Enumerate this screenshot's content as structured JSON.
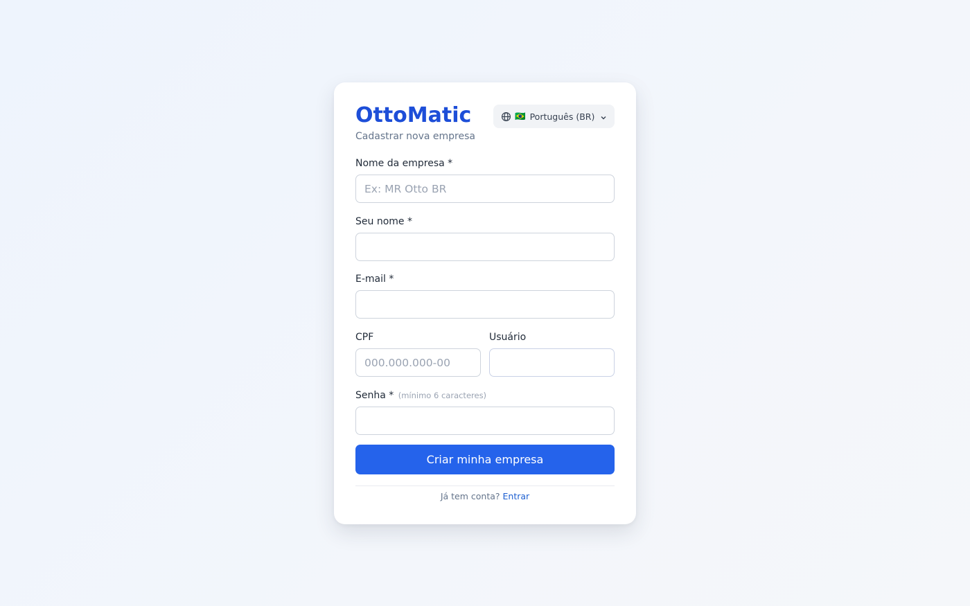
{
  "brand": {
    "name": "OttoMatic",
    "subtitle": "Cadastrar nova empresa"
  },
  "language": {
    "flag": "🇧🇷",
    "label": "Português (BR)",
    "icon": "globe-icon"
  },
  "form": {
    "company": {
      "label": "Nome da empresa *",
      "placeholder": "Ex: MR Otto BR",
      "value": ""
    },
    "name": {
      "label": "Seu nome *",
      "placeholder": "",
      "value": ""
    },
    "email": {
      "label": "E-mail *",
      "placeholder": "",
      "value": ""
    },
    "cpf": {
      "label": "CPF",
      "placeholder": "000.000.000-00",
      "value": ""
    },
    "username": {
      "label": "Usuário",
      "placeholder": "",
      "value": ""
    },
    "password": {
      "label": "Senha *",
      "hint": "(mínimo 6 caracteres)",
      "placeholder": "",
      "value": ""
    },
    "submit_label": "Criar minha empresa"
  },
  "footer": {
    "prompt": "Já tem conta?",
    "link": "Entrar"
  },
  "colors": {
    "accent": "#2563eb",
    "brand": "#1d4ed8",
    "background": "#eef4fd"
  }
}
